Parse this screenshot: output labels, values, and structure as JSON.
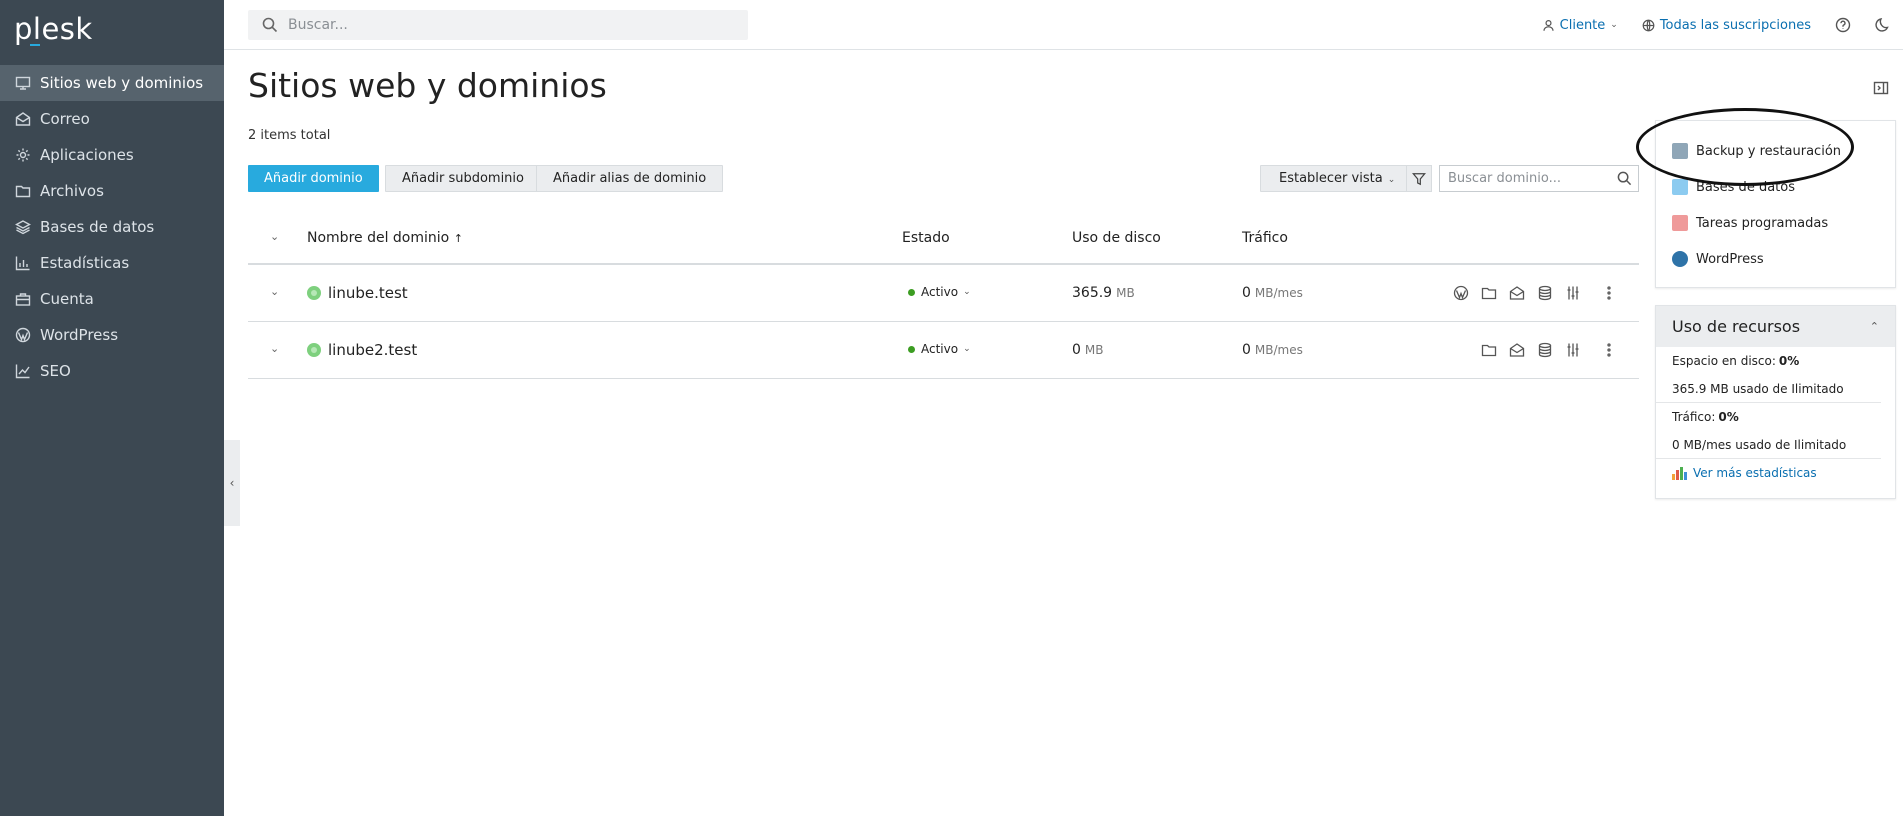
{
  "sidebar": {
    "logo": "plesk",
    "items": [
      {
        "label": "Sitios web y dominios",
        "icon": "monitor-icon",
        "active": true
      },
      {
        "label": "Correo",
        "icon": "mail-icon"
      },
      {
        "label": "Aplicaciones",
        "icon": "gear-icon"
      },
      {
        "label": "Archivos",
        "icon": "folder-icon"
      },
      {
        "label": "Bases de datos",
        "icon": "layers-icon"
      },
      {
        "label": "Estadísticas",
        "icon": "bar-chart-icon"
      },
      {
        "label": "Cuenta",
        "icon": "briefcase-icon"
      },
      {
        "label": "WordPress",
        "icon": "wordpress-icon"
      },
      {
        "label": "SEO",
        "icon": "trend-icon"
      }
    ]
  },
  "topbar": {
    "search_placeholder": "Buscar...",
    "client_label": "Cliente",
    "subscriptions_label": "Todas las suscripciones"
  },
  "main": {
    "title": "Sitios web y dominios",
    "items_total": "2 items total",
    "buttons": {
      "add_domain": "Añadir dominio",
      "add_subdomain": "Añadir subdominio",
      "add_alias": "Añadir alias de dominio",
      "set_view": "Establecer vista"
    },
    "domain_search_placeholder": "Buscar dominio...",
    "columns": {
      "name": "Nombre del dominio",
      "sort_indicator": "↑",
      "status": "Estado",
      "disk": "Uso de disco",
      "traffic": "Tráfico"
    },
    "rows": [
      {
        "name": "linube.test",
        "status": "Activo",
        "disk_value": "365.9",
        "disk_unit": "MB",
        "traffic_value": "0",
        "traffic_unit": "MB/mes",
        "has_wordpress": true
      },
      {
        "name": "linube2.test",
        "status": "Activo",
        "disk_value": "0",
        "disk_unit": "MB",
        "traffic_value": "0",
        "traffic_unit": "MB/mes",
        "has_wordpress": false
      }
    ]
  },
  "right_panel": {
    "links": [
      {
        "label": "Backup y restauración",
        "color": "#5f7f96"
      },
      {
        "label": "Bases de datos",
        "color": "#6cb6e6"
      },
      {
        "label": "Tareas programadas",
        "color": "#e57373"
      },
      {
        "label": "WordPress",
        "color": "#2e73a8"
      }
    ],
    "resources": {
      "title": "Uso de recursos",
      "disk_label": "Espacio en disco:",
      "disk_percent": "0%",
      "disk_used": "365.9 MB usado de Ilimitado",
      "traffic_label": "Tráfico:",
      "traffic_percent": "0%",
      "traffic_used": "0 MB/mes usado de Ilimitado",
      "more_stats": "Ver más estadísticas"
    }
  },
  "colors": {
    "sidebar_bg": "#3c4852",
    "accent": "#28aade",
    "link": "#0a6fb0",
    "status_active": "#3c9d22"
  }
}
